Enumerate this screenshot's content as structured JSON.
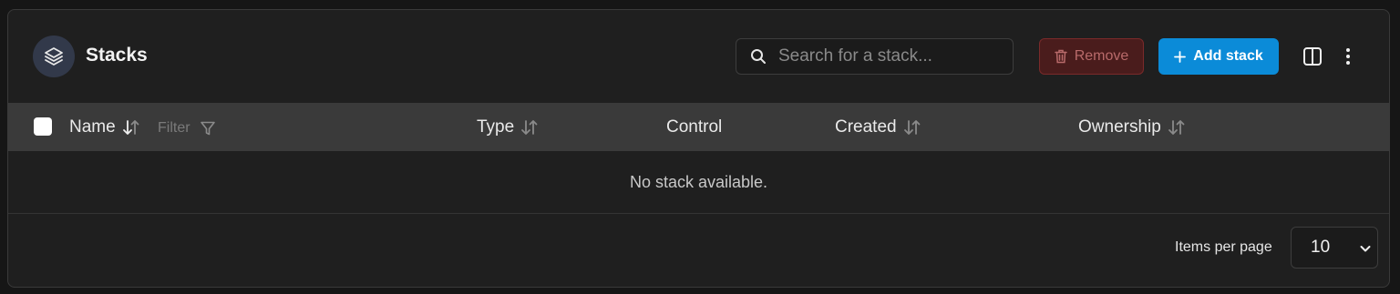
{
  "header": {
    "title": "Stacks",
    "title_icon": "layers-icon",
    "search": {
      "placeholder": "Search for a stack...",
      "value": ""
    },
    "remove_label": "Remove",
    "add_label": "Add stack"
  },
  "table": {
    "columns": [
      {
        "label": "Name",
        "sort_icon": "sort-icon"
      },
      {
        "label": "Type",
        "sort_icon": "sort-icon"
      },
      {
        "label": "Control"
      },
      {
        "label": "Created",
        "sort_icon": "sort-icon"
      },
      {
        "label": "Ownership",
        "sort_icon": "sort-icon"
      }
    ],
    "filter_label": "Filter",
    "empty_message": "No stack available."
  },
  "footer": {
    "items_per_page_label": "Items per page",
    "items_per_page_value": "10"
  },
  "colors": {
    "accent": "#0b8bd8",
    "danger_bg": "#4a1c1c",
    "panel_bg": "#1f1f1f",
    "header_row_bg": "#3a3a3a"
  }
}
